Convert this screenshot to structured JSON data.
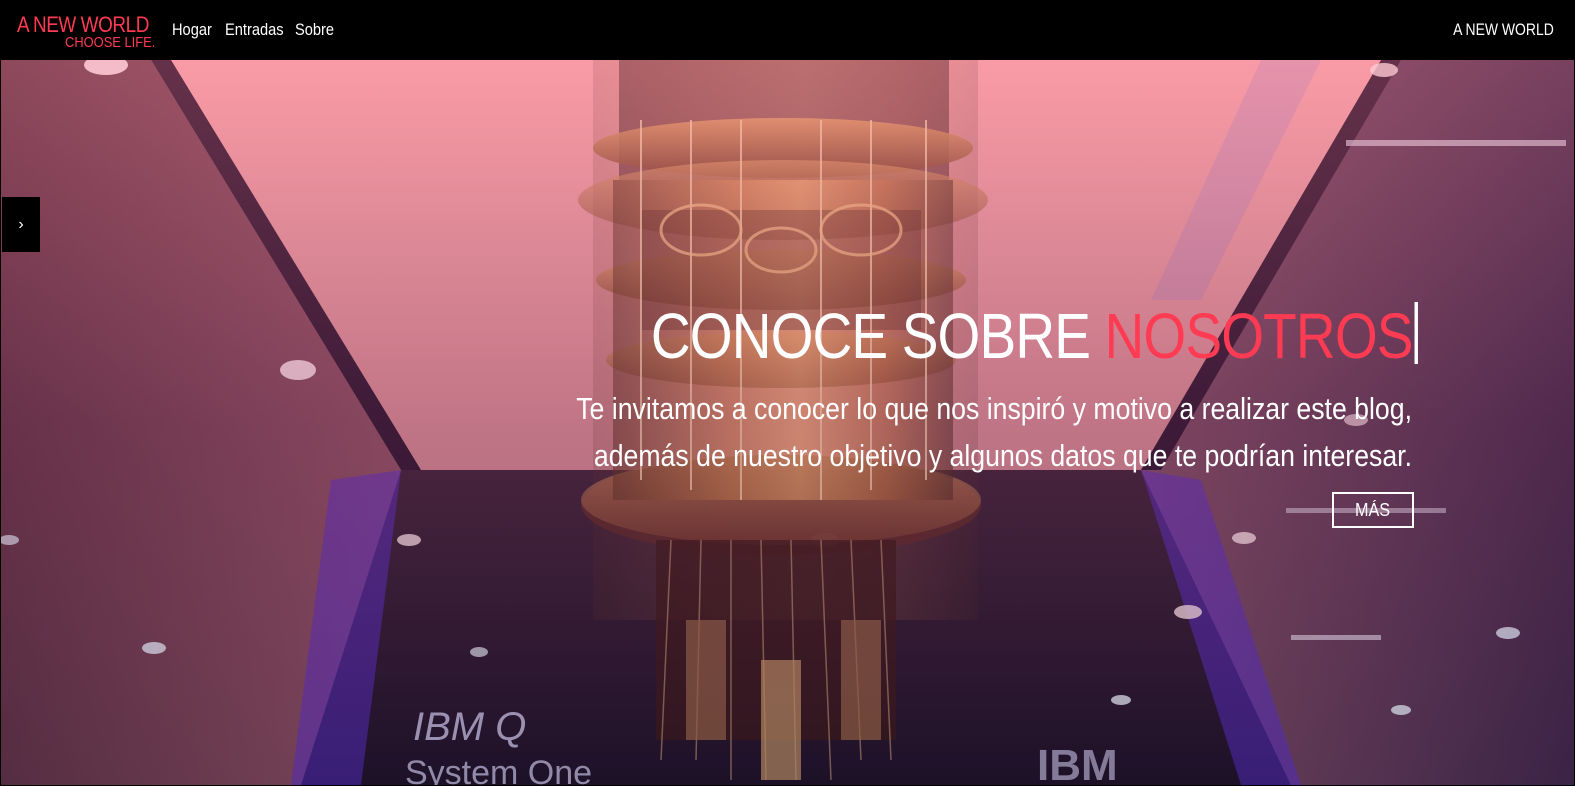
{
  "brand": {
    "title": "A NEW WORLD",
    "tagline": "CHOOSE LIFE.",
    "color": "#ff3b53"
  },
  "nav": {
    "links": [
      "Hogar",
      "Entradas",
      "Sobre"
    ],
    "right_label": "A NEW WORLD"
  },
  "carousel": {
    "next_icon": "chevron-right-icon",
    "next_glyph": "›"
  },
  "hero": {
    "headline_main": "CONOCE SOBRE ",
    "headline_accent": "NOSOTROS",
    "line1": "Te invitamos a conocer lo que nos inspiró y motivo a realizar este blog,",
    "line2": "además de nuestro objetivo y algunos datos que te podrían interesar.",
    "button_label": "MÁS",
    "accent_color": "#ff3b53",
    "background_labels": [
      "IBM Q",
      "System One",
      "IBM"
    ]
  }
}
